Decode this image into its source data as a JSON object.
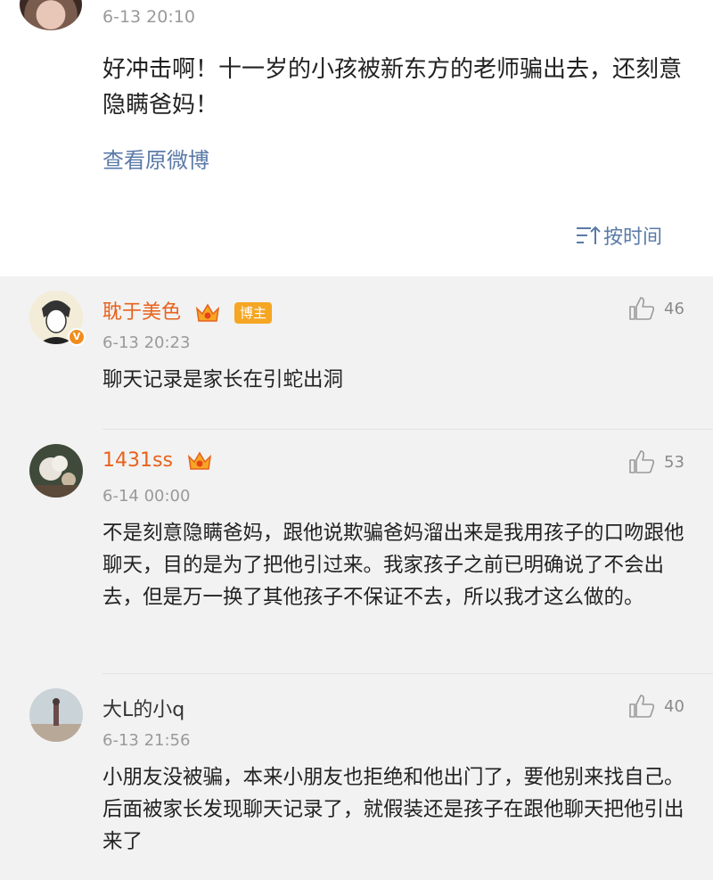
{
  "post": {
    "time": "6-13 20:10",
    "text": "好冲击啊！十一岁的小孩被新东方的老师骗出去，还刻意隐瞒爸妈！",
    "view_original": "查看原微博",
    "sort_label": "按时间"
  },
  "comments": [
    {
      "name": "耽于美色",
      "badge": "博主",
      "time": "6-13 20:23",
      "text": "聊天记录是家长在引蛇出洞",
      "likes": "46",
      "name_color": "#e8621c"
    },
    {
      "name": "1431ss",
      "time": "6-14 00:00",
      "text": "不是刻意隐瞒爸妈，跟他说欺骗爸妈溜出来是我用孩子的口吻跟他聊天，目的是为了把他引过来。我家孩子之前已明确说了不会出去，但是万一换了其他孩子不保证不去，所以我才这么做的。",
      "likes": "53",
      "name_color": "#e8621c"
    },
    {
      "name": "大L的小q",
      "time": "6-13 21:56",
      "text": "小朋友没被骗，本来小朋友也拒绝和他出门了，要他别来找自己。后面被家长发现聊天记录了，就假装还是孩子在跟他聊天把他引出来了",
      "likes": "40",
      "name_color": "#333333"
    }
  ]
}
